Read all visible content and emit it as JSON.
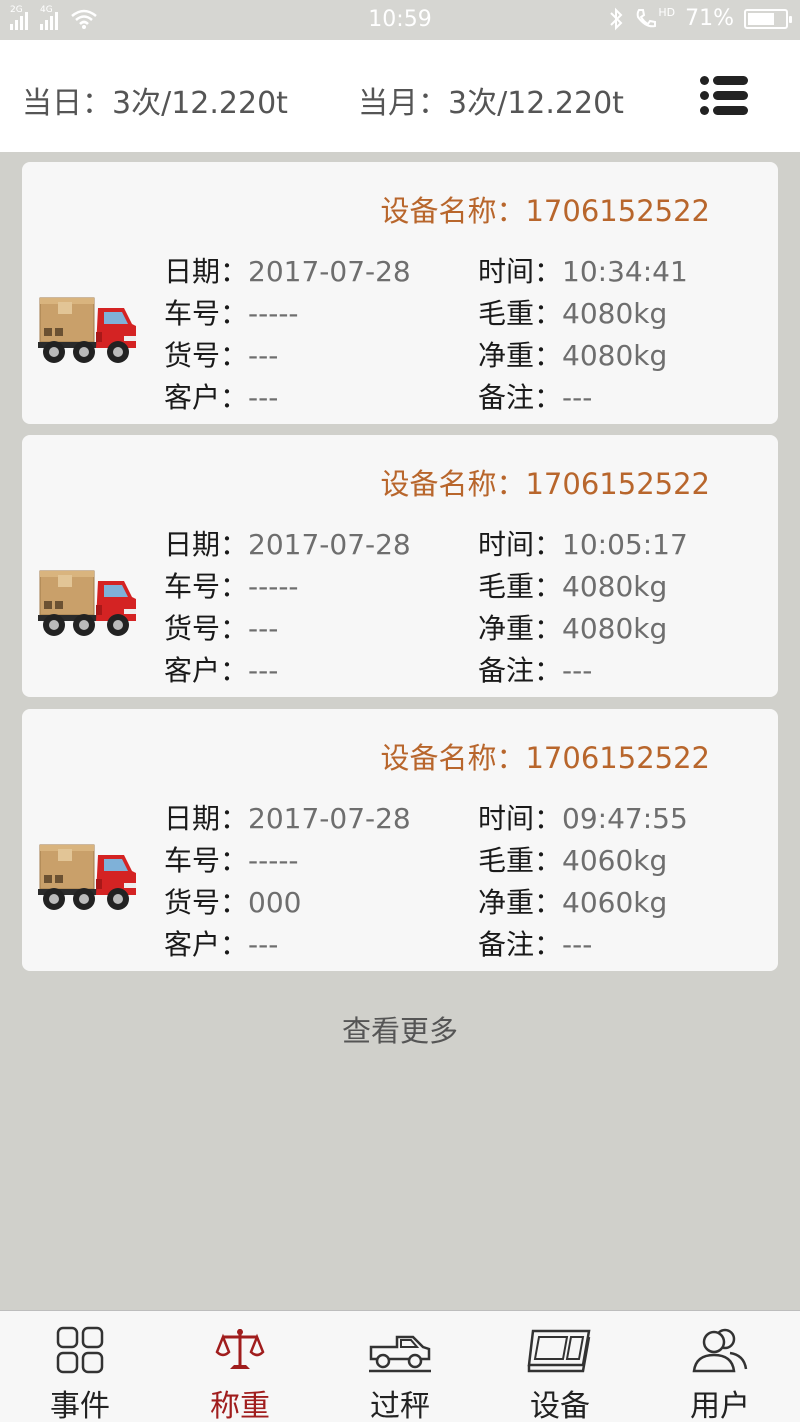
{
  "status_bar": {
    "network1": "2G",
    "network2": "4G",
    "time": "10:59",
    "hd": "HD",
    "battery": "71%",
    "battery_level": 0.71
  },
  "summary": {
    "today": "当日：3次/12.220t",
    "month": "当月：3次/12.220t"
  },
  "labels": {
    "date": "日期：",
    "time": "时间：",
    "plate": "车号：",
    "gross": "毛重：",
    "cargo": "货号：",
    "net": "净重：",
    "customer": "客户：",
    "note": "备注："
  },
  "records": [
    {
      "device": "设备名称：1706152522",
      "date": "2017-07-28",
      "time": "10:34:41",
      "plate": "-----",
      "gross": "4080kg",
      "cargo": "---",
      "net": "4080kg",
      "customer": "---",
      "note": "---"
    },
    {
      "device": "设备名称：1706152522",
      "date": "2017-07-28",
      "time": "10:05:17",
      "plate": "-----",
      "gross": "4080kg",
      "cargo": "---",
      "net": "4080kg",
      "customer": "---",
      "note": "---"
    },
    {
      "device": "设备名称：1706152522",
      "date": "2017-07-28",
      "time": "09:47:55",
      "plate": "-----",
      "gross": "4060kg",
      "cargo": "000",
      "net": "4060kg",
      "customer": "---",
      "note": "---"
    }
  ],
  "more_label": "查看更多",
  "nav": {
    "active": "称重",
    "active_color": "#a01d1d",
    "items": [
      {
        "label": "事件",
        "icon": "grid-icon"
      },
      {
        "label": "称重",
        "icon": "scale-icon"
      },
      {
        "label": "过秤",
        "icon": "pickup-truck-icon"
      },
      {
        "label": "设备",
        "icon": "device-icon"
      },
      {
        "label": "用户",
        "icon": "users-icon"
      }
    ]
  }
}
